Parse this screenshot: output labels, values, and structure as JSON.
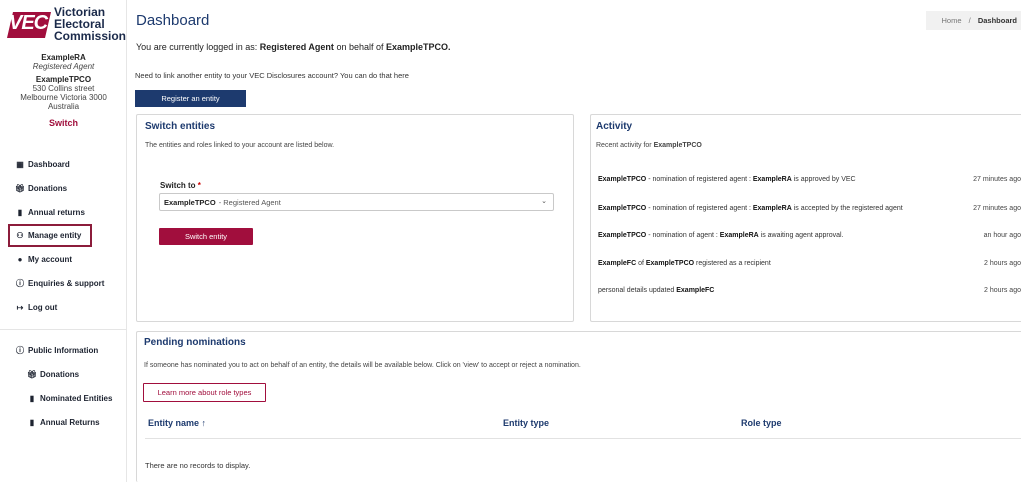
{
  "brand": {
    "logo_text": "VEC",
    "name_lines": [
      "Victorian",
      "Electoral",
      "Commission"
    ],
    "color": "#a10e3d"
  },
  "user": {
    "name": "ExampleRA",
    "role": "Registered Agent",
    "entity_name": "ExampleTPCO",
    "address_line1": "530 Collins street",
    "address_line2": "Melbourne Victoria 3000",
    "address_line3": "Australia",
    "switch_label": "Switch"
  },
  "nav": {
    "items": [
      {
        "label": "Dashboard",
        "icon": "grid-icon"
      },
      {
        "label": "Donations",
        "icon": "gift-icon"
      },
      {
        "label": "Annual returns",
        "icon": "file-icon"
      },
      {
        "label": "Manage entity",
        "icon": "users-icon",
        "active": true
      },
      {
        "label": "My account",
        "icon": "user-icon"
      },
      {
        "label": "Enquiries & support",
        "icon": "info-icon"
      },
      {
        "label": "Log out",
        "icon": "logout-icon"
      }
    ],
    "public": {
      "label": "Public Information",
      "items": [
        {
          "label": "Donations"
        },
        {
          "label": "Nominated Entities"
        },
        {
          "label": "Annual Returns"
        }
      ]
    }
  },
  "header": {
    "title": "Dashboard",
    "breadcrumb_home": "Home",
    "breadcrumb_sep": "/",
    "breadcrumb_current": "Dashboard"
  },
  "login": {
    "prefix": "You are currently logged in as: ",
    "role": "Registered Agent",
    "middle": " on behalf of ",
    "entity": "ExampleTPCO."
  },
  "link_text": "Need to link another entity to your VEC Disclosures account? You can do that here",
  "register_button": "Register an entity",
  "switch_card": {
    "title": "Switch entities",
    "subtitle": "The entities and roles linked to your account are listed below.",
    "label": "Switch to",
    "required_mark": "*",
    "selected_entity": "ExampleTPCO",
    "selected_role": "- Registered Agent",
    "button": "Switch entity"
  },
  "activity": {
    "title": "Activity",
    "subtitle_prefix": "Recent activity for ",
    "subtitle_entity": "ExampleTPCO",
    "rows": [
      {
        "a": "ExampleTPCO",
        "b": " - nomination of registered agent : ",
        "c": "ExampleRA",
        "d": " is approved by VEC",
        "time": "27 minutes ago"
      },
      {
        "a": "ExampleTPCO",
        "b": " - nomination of registered agent : ",
        "c": "ExampleRA",
        "d": " is accepted by the registered agent",
        "time": "27 minutes ago"
      },
      {
        "a": "ExampleTPCO",
        "b": " - nomination of agent : ",
        "c": "ExampleRA",
        "d": " is awaiting agent approval.",
        "time": "an hour ago"
      },
      {
        "a": "ExampleFC",
        "b": " of ",
        "c": "ExampleTPCO",
        "d": " registered as a recipient",
        "time": "2 hours ago"
      },
      {
        "a": "",
        "b": "personal details updated ",
        "c": "ExampleFC",
        "d": "",
        "time": "2 hours ago"
      }
    ]
  },
  "pending": {
    "title": "Pending nominations",
    "subtitle": "If someone has nominated you to act on behalf of an entity, the details will be available below. Click on 'view' to accept or reject a nomination.",
    "learn_button": "Learn more about role types",
    "columns": [
      "Entity name ↑",
      "Entity type",
      "Role type"
    ],
    "empty": "There are no records to display."
  }
}
